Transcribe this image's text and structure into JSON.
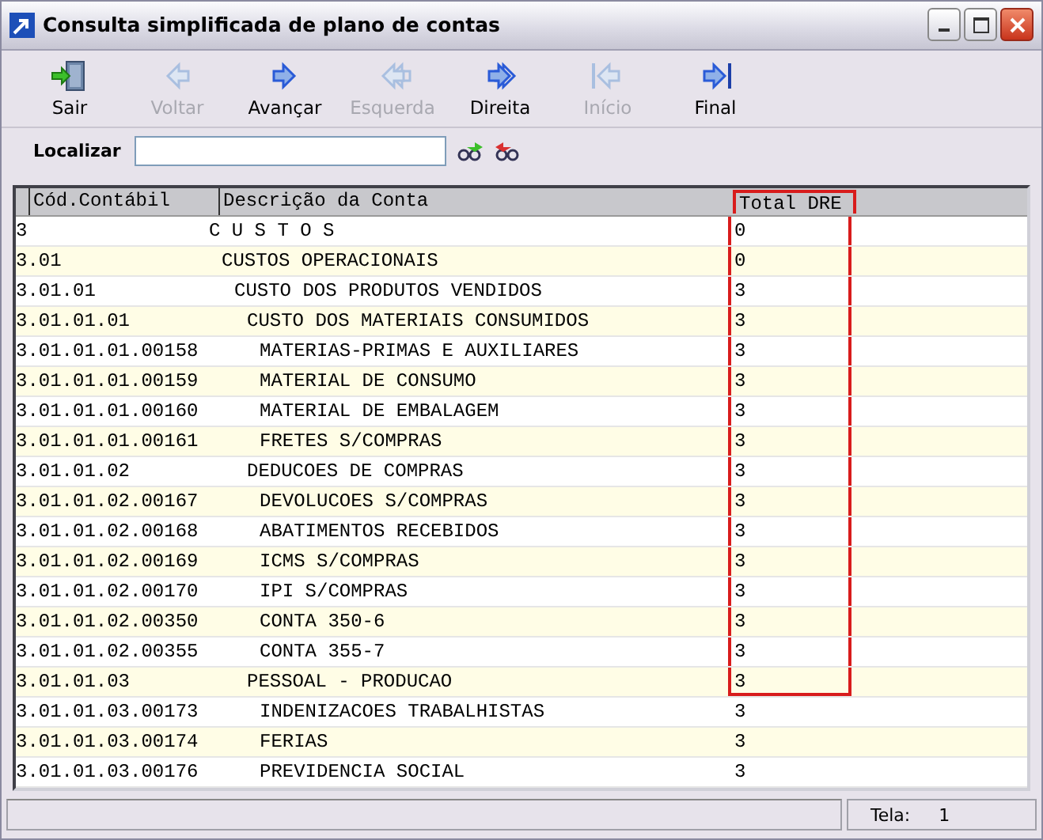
{
  "window": {
    "title": "Consulta simplificada de plano de contas"
  },
  "toolbar": [
    {
      "kind": "exit",
      "label": "Sair",
      "disabled": false
    },
    {
      "kind": "back",
      "label": "Voltar",
      "disabled": true
    },
    {
      "kind": "next",
      "label": "Avançar",
      "disabled": false
    },
    {
      "kind": "left",
      "label": "Esquerda",
      "disabled": true
    },
    {
      "kind": "right",
      "label": "Direita",
      "disabled": false
    },
    {
      "kind": "first",
      "label": "Início",
      "disabled": true
    },
    {
      "kind": "last",
      "label": "Final",
      "disabled": false
    }
  ],
  "search": {
    "label": "Localizar"
  },
  "table": {
    "columns": [
      {
        "label": "Cód.Contábil",
        "highlighted": false
      },
      {
        "label": "Descrição da Conta",
        "highlighted": false
      },
      {
        "label": "Total DRE",
        "highlighted": true
      }
    ],
    "rows": [
      {
        "code": "3",
        "description": "C U S T O S",
        "total": "0",
        "highlighted": true,
        "children": [
          {
            "code": "3.01",
            "description": "CUSTOS OPERACIONAIS",
            "total": "0",
            "highlighted": true,
            "children": [
              {
                "code": "3.01.01",
                "description": "CUSTO DOS PRODUTOS VENDIDOS",
                "total": "3",
                "highlighted": true,
                "children": [
                  {
                    "code": "3.01.01.01",
                    "description": "CUSTO DOS MATERIAIS CONSUMIDOS",
                    "total": "3",
                    "highlighted": true,
                    "children": [
                      {
                        "code": "3.01.01.01.00158",
                        "description": "MATERIAS-PRIMAS E AUXILIARES",
                        "total": "3",
                        "highlighted": true
                      },
                      {
                        "code": "3.01.01.01.00159",
                        "description": "MATERIAL DE CONSUMO",
                        "total": "3",
                        "highlighted": true
                      },
                      {
                        "code": "3.01.01.01.00160",
                        "description": "MATERIAL DE EMBALAGEM",
                        "total": "3",
                        "highlighted": true
                      },
                      {
                        "code": "3.01.01.01.00161",
                        "description": "FRETES S/COMPRAS",
                        "total": "3",
                        "highlighted": true
                      }
                    ]
                  },
                  {
                    "code": "3.01.01.02",
                    "description": "DEDUCOES DE COMPRAS",
                    "total": "3",
                    "highlighted": true,
                    "children": [
                      {
                        "code": "3.01.01.02.00167",
                        "description": "DEVOLUCOES S/COMPRAS",
                        "total": "3",
                        "highlighted": true
                      },
                      {
                        "code": "3.01.01.02.00168",
                        "description": "ABATIMENTOS RECEBIDOS",
                        "total": "3",
                        "highlighted": true
                      },
                      {
                        "code": "3.01.01.02.00169",
                        "description": "ICMS S/COMPRAS",
                        "total": "3",
                        "highlighted": true
                      },
                      {
                        "code": "3.01.01.02.00170",
                        "description": "IPI S/COMPRAS",
                        "total": "3",
                        "highlighted": true
                      },
                      {
                        "code": "3.01.01.02.00350",
                        "description": "CONTA 350-6",
                        "total": "3",
                        "highlighted": true
                      },
                      {
                        "code": "3.01.01.02.00355",
                        "description": "CONTA 355-7",
                        "total": "3",
                        "highlighted": true
                      }
                    ]
                  },
                  {
                    "code": "3.01.01.03",
                    "description": "PESSOAL - PRODUCAO",
                    "total": "3",
                    "highlighted": true,
                    "children": [
                      {
                        "code": "3.01.01.03.00173",
                        "description": "INDENIZACOES TRABALHISTAS",
                        "total": "3",
                        "highlighted": false
                      },
                      {
                        "code": "3.01.01.03.00174",
                        "description": "FERIAS",
                        "total": "3",
                        "highlighted": false
                      },
                      {
                        "code": "3.01.01.03.00176",
                        "description": "PREVIDENCIA SOCIAL",
                        "total": "3",
                        "highlighted": false
                      }
                    ]
                  }
                ]
              }
            ]
          }
        ]
      }
    ]
  },
  "status_bar": {
    "label": "Tela:",
    "value": "1"
  }
}
